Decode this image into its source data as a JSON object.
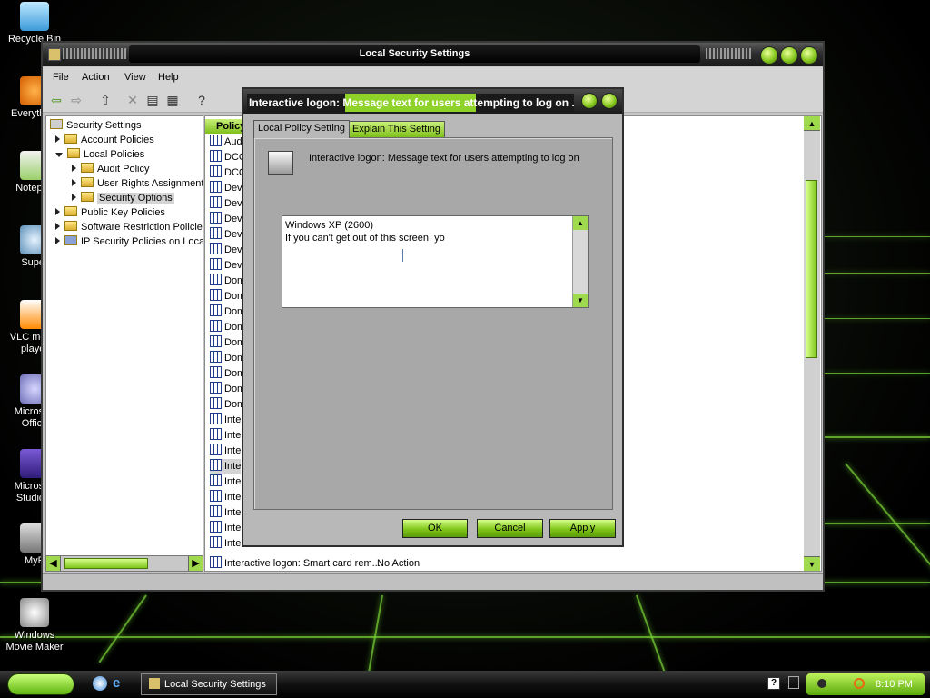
{
  "desktop": {
    "icons": [
      {
        "label": "Recycle Bin",
        "name": "recycle-bin"
      },
      {
        "label": "Everything",
        "name": "everything"
      },
      {
        "label": "Notepad",
        "name": "notepad"
      },
      {
        "label": "Super",
        "name": "super"
      },
      {
        "label": "VLC media player",
        "name": "vlc"
      },
      {
        "label": "Microsoft Office",
        "name": "ms-office"
      },
      {
        "label": "Microsoft Studio 2",
        "name": "ms-studio"
      },
      {
        "label": "MyP",
        "name": "myp"
      },
      {
        "label": "Windows Movie Maker",
        "name": "movie-maker"
      }
    ]
  },
  "window": {
    "title": "Local Security Settings",
    "menu": [
      "File",
      "Action",
      "View",
      "Help"
    ],
    "tree": [
      {
        "label": "Security Settings",
        "level": 0
      },
      {
        "label": "Account Policies",
        "level": 1
      },
      {
        "label": "Local Policies",
        "level": 1
      },
      {
        "label": "Audit Policy",
        "level": 2
      },
      {
        "label": "User Rights Assignment",
        "level": 2
      },
      {
        "label": "Security Options",
        "level": 2
      },
      {
        "label": "Public Key Policies",
        "level": 1
      },
      {
        "label": "Software Restriction Policies",
        "level": 1
      },
      {
        "label": "IP Security Policies on Local Computer",
        "level": 1
      }
    ],
    "list_header": "Policy",
    "list_rows": [
      "Aud",
      "DCC",
      "DCC",
      "Dev",
      "Dev",
      "Dev",
      "Dev",
      "Dev",
      "Dev",
      "Dom",
      "Dom",
      "Dom",
      "Dom",
      "Dom",
      "Dom",
      "Dom",
      "Dom",
      "Dom",
      "Inte",
      "Inte",
      "Inte",
      "Inte",
      "Inte",
      "Inte",
      "Inte",
      "Inte",
      "Inte"
    ],
    "bottom_row": {
      "policy": "Interactive logon: Smart card rem...",
      "setting": "No Action"
    }
  },
  "dialog": {
    "title": "Interactive logon: Message text for users attempting to log on ...",
    "tabs": [
      "Local Policy Setting",
      "Explain This Setting"
    ],
    "description": "Interactive logon: Message text for users attempting to log on",
    "text_line1": "Windows XP (2600)",
    "text_line2": "If you can't get out of this screen, yo",
    "buttons": {
      "ok": "OK",
      "cancel": "Cancel",
      "apply": "Apply"
    }
  },
  "taskbar": {
    "task_label": "Local Security Settings",
    "clock": "8:10 PM"
  },
  "colors": {
    "accent": "#8fd32a",
    "titlebar": "#1a1a1a"
  }
}
